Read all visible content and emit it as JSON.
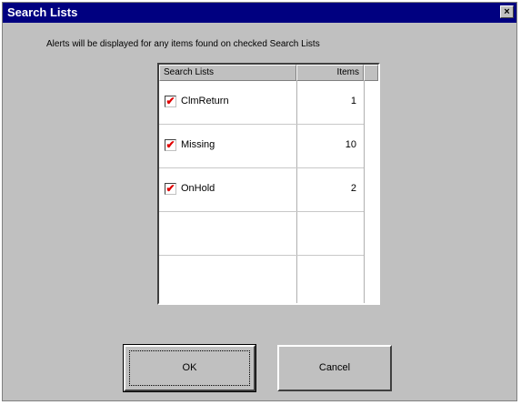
{
  "window": {
    "title": "Search Lists",
    "close_glyph": "×"
  },
  "instructions": "Alerts will be displayed for any items found on checked Search Lists",
  "table": {
    "columns": [
      "Search Lists",
      "Items"
    ],
    "rows": [
      {
        "name": "ClmReturn",
        "items": "1",
        "checked": true
      },
      {
        "name": "Missing",
        "items": "10",
        "checked": true
      },
      {
        "name": "OnHold",
        "items": "2",
        "checked": true
      }
    ]
  },
  "buttons": {
    "ok_label": "OK",
    "cancel_label": "Cancel"
  },
  "icons": {
    "checkbox_mark": "✔",
    "close": "close-icon"
  },
  "colors": {
    "titlebar": "#000080",
    "dialog_bg": "#c0c0c0",
    "check_mark": "#e00000"
  }
}
